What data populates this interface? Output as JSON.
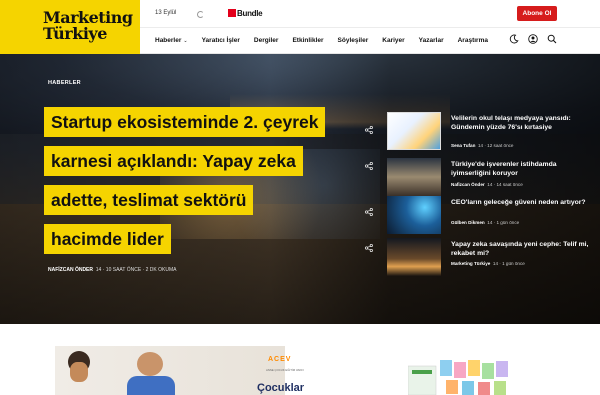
{
  "header": {
    "logo_line1": "Marketing",
    "logo_line2": "Türkiye",
    "date": "13 Eylül",
    "bundle_label": "Bundle",
    "subscribe_label": "Abone Ol",
    "nav": [
      {
        "label": "Haberler"
      },
      {
        "label": "Yaratıcı İşler"
      },
      {
        "label": "Dergiler"
      },
      {
        "label": "Etkinlikler"
      },
      {
        "label": "Söyleşiler"
      },
      {
        "label": "Kariyer"
      },
      {
        "label": "Yazarlar"
      },
      {
        "label": "Araştırma"
      }
    ],
    "icons": [
      "moon-icon",
      "user-icon",
      "search-icon"
    ],
    "colors": {
      "brand_yellow": "#f5d400",
      "subscribe_red": "#d61c1c"
    }
  },
  "hero": {
    "section": "HABERLER",
    "headline_lines": [
      "Startup ekosisteminde 2. çeyrek",
      "karnesi açıklandı: Yapay zeka",
      "adette, teslimat sektörü",
      "hacimde lider"
    ],
    "author": "NAFİZCAN ÖNDER",
    "meta": "14 · 10 SAAT ÖNCE · 2 DK OKUMA"
  },
  "side_news": [
    {
      "title": "Velilerin okul telaşı medyaya yansıdı: Gündemin yüzde 76'sı kırtasiye",
      "author": "Sena Tufan",
      "meta": "14 · 12 saat önce"
    },
    {
      "title": "Türkiye'de işverenler istihdamda iyimserliğini koruyor",
      "author": "Nafizcan Önder",
      "meta": "14 · 14 saat önce"
    },
    {
      "title": "CEO'ların geleceğe güveni neden artıyor?",
      "author": "Gülben Dikmen",
      "meta": "14 · 1 gün önce"
    },
    {
      "title": "Yapay zeka savaşında yeni cephe: Telif mi, rekabet mi?",
      "author": "Marketing Türkiye",
      "meta": "14 · 1 gün önce"
    }
  ],
  "bottom": {
    "acev_logo": "ACEV",
    "acev_sub": "ANNE ÇOCUK EĞİTİM VAKFI",
    "promo_title": "Çocuklar"
  }
}
